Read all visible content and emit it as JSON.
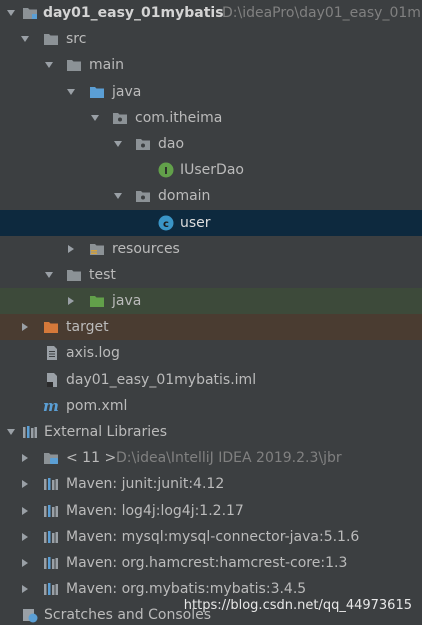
{
  "colors": {
    "panel_background": "#3c3f41",
    "selection": "#0d293e",
    "test_row": "#3d4a3a",
    "target_row": "#4a3c31",
    "folder_gray": "#8c9296",
    "source_folder_blue": "#5b9fd5",
    "test_folder_green": "#62a04a",
    "excluded_orange": "#d6793a",
    "interface_green": "#62a04a",
    "class_blue": "#3a95c7"
  },
  "tree": {
    "project": {
      "name": "day01_easy_01mybatis",
      "path": "D:\\ideaPro\\day01_easy_01m",
      "icon": "module-folder-icon"
    },
    "src": {
      "label": "src",
      "icon": "folder-icon"
    },
    "main": {
      "label": "main",
      "icon": "folder-icon"
    },
    "java_main": {
      "label": "java",
      "icon": "source-folder-icon"
    },
    "package": {
      "label": "com.itheima",
      "icon": "package-icon"
    },
    "dao": {
      "label": "dao",
      "icon": "package-icon"
    },
    "iuserdao": {
      "label": "IUserDao",
      "icon": "interface-icon"
    },
    "domain": {
      "label": "domain",
      "icon": "package-icon"
    },
    "user": {
      "label": "user",
      "icon": "class-icon"
    },
    "resources": {
      "label": "resources",
      "icon": "resources-folder-icon"
    },
    "test": {
      "label": "test",
      "icon": "folder-icon"
    },
    "java_test": {
      "label": "java",
      "icon": "test-source-folder-icon"
    },
    "target": {
      "label": "target",
      "icon": "excluded-folder-icon"
    },
    "axis_log": {
      "label": "axis.log",
      "icon": "file-icon"
    },
    "iml": {
      "label": "day01_easy_01mybatis.iml",
      "icon": "iml-file-icon"
    },
    "pom": {
      "label": "pom.xml",
      "icon": "maven-icon"
    },
    "external_libraries": {
      "label": "External Libraries",
      "icon": "libraries-icon"
    },
    "jdk": {
      "label": "< 11 >",
      "path": "D:\\idea\\IntelliJ IDEA 2019.2.3\\jbr",
      "icon": "jdk-icon"
    },
    "libs": [
      {
        "label": "Maven: junit:junit:4.12",
        "icon": "library-icon"
      },
      {
        "label": "Maven: log4j:log4j:1.2.17",
        "icon": "library-icon"
      },
      {
        "label": "Maven: mysql:mysql-connector-java:5.1.6",
        "icon": "library-icon"
      },
      {
        "label": "Maven: org.hamcrest:hamcrest-core:1.3",
        "icon": "library-icon"
      },
      {
        "label": "Maven: org.mybatis:mybatis:3.4.5",
        "icon": "library-icon"
      }
    ],
    "scratches": {
      "label": "Scratches and Consoles",
      "icon": "scratches-icon"
    }
  },
  "watermark": "https://blog.csdn.net/qq_44973615"
}
